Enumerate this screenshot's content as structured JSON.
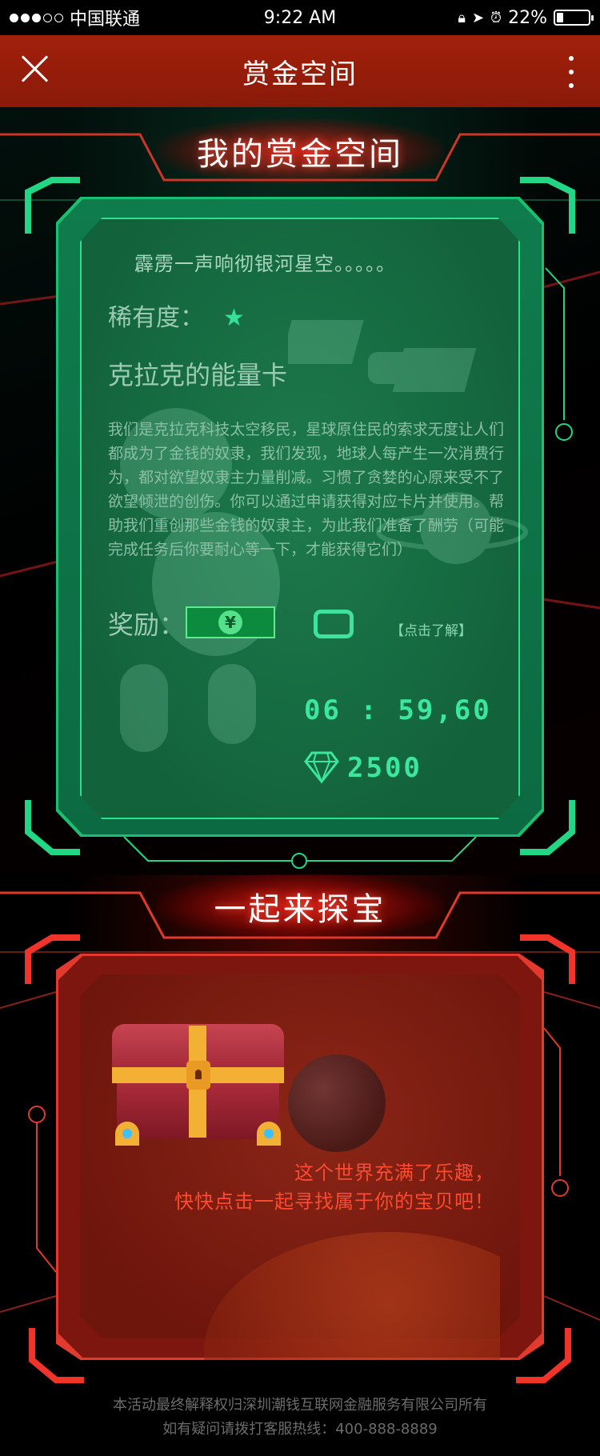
{
  "status_bar": {
    "carrier": "中国联通",
    "time": "9:22 AM",
    "battery": "22%",
    "battery_level": 0.22
  },
  "nav": {
    "title": "赏金空间"
  },
  "bounty_section": {
    "title": "我的赏金空间",
    "quote": "霹雳一声响彻银河星空。。。。。",
    "rarity_label": "稀有度：",
    "rarity_stars": "★",
    "card_name": "克拉克的能量卡",
    "description": "我们是克拉克科技太空移民，星球原住民的索求无度让人们都成为了金钱的奴隶，我们发现，地球人每产生一次消费行为，都对欲望奴隶主力量削减。习惯了贪婪的心原来受不了欲望倾泄的创伤。你可以通过申请获得对应卡片并使用。帮助我们重创那些金钱的奴隶主，为此我们准备了酬劳（可能完成任务后你要耐心等一下，才能获得它们）",
    "reward_label": "奖励：",
    "money_symbol": "¥",
    "learn_more": "【点击了解】",
    "countdown": "06 : 59,60",
    "gems": "2500"
  },
  "treasure_section": {
    "title": "一起来探宝",
    "message_line1": "这个世界充满了乐趣，",
    "message_line2": "快快点击一起寻找属于你的宝贝吧！"
  },
  "footer": {
    "line1": "本活动最终解释权归深圳潮钱互联网金融服务有限公司所有",
    "line2": "如有疑问请拨打客服热线：400-888-8889"
  },
  "colors": {
    "nav_bg": "#9a1e0a",
    "green_accent": "#3be79d",
    "red_accent": "#ff4a2f"
  }
}
